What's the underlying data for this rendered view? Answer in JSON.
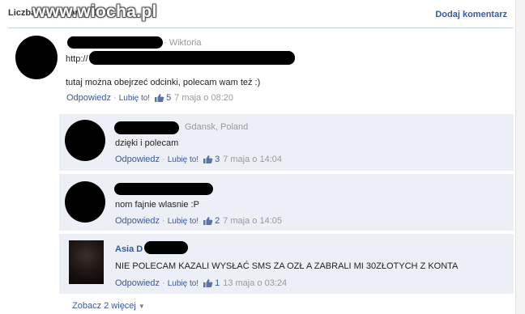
{
  "header": {
    "title": "Liczba komentarzy: 1",
    "watermark": "www.wiocha.pl",
    "add_comment": "Dodaj komentarz"
  },
  "comments": [
    {
      "location": "· Wiktoria",
      "text_line1": "http://",
      "text_line2": "tutaj można obejrzeć odcinki, polecam wam też :)",
      "reply": "Odpowiedz",
      "like": "Lubię to!",
      "likes": "5",
      "date": "7 maja o 08:20"
    },
    {
      "location": "Gdansk, Poland",
      "text": "dzięki i polecam",
      "reply": "Odpowiedz",
      "like": "Lubię to!",
      "likes": "3",
      "date": "7 maja o 14:04"
    },
    {
      "text": "nom fajnie wlasnie :P",
      "reply": "Odpowiedz",
      "like": "Lubię to!",
      "likes": "2",
      "date": "7 maja o 14:05"
    },
    {
      "name": "Asia D",
      "text": "NIE POLECAM KAZALI WYSŁAĆ SMS ZA OZŁ A ZABRALI MI 30ZŁOTYCH Z KONTA",
      "reply": "Odpowiedz",
      "like": "Lubię to!",
      "likes": "1",
      "date": "13 maja o 03:24"
    }
  ],
  "more": {
    "label": "Zobacz 2 więcej"
  },
  "icons": {
    "like": "thumbs-up-icon",
    "caret": "caret-down-icon"
  },
  "colors": {
    "link": "#3b5998",
    "reply_bg": "#eceff5",
    "muted": "#999999"
  }
}
